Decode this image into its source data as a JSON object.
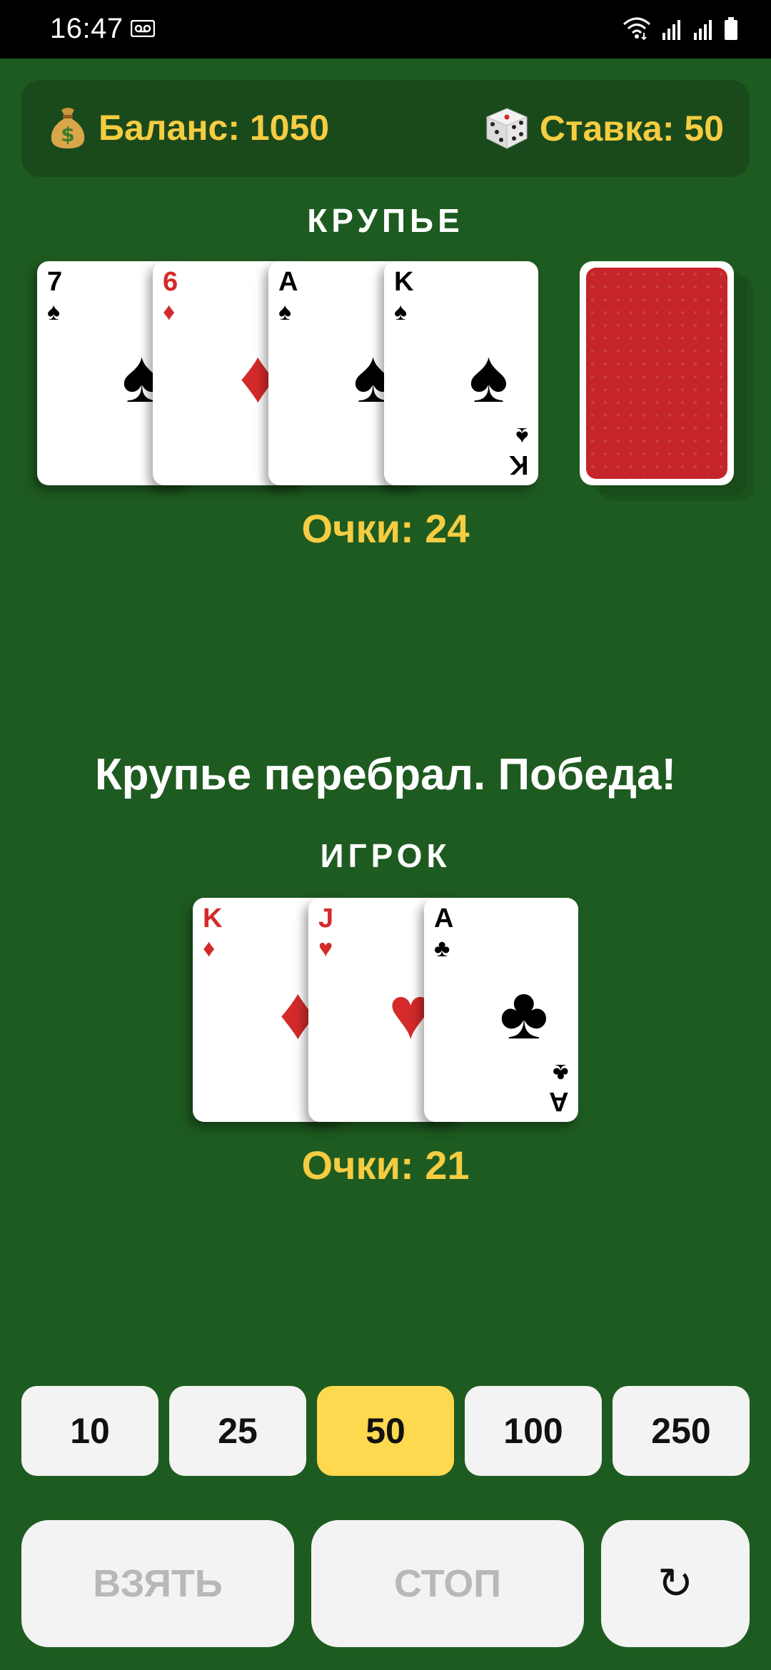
{
  "status_bar": {
    "time": "16:47"
  },
  "info": {
    "balance_label": "Баланс: 1050",
    "bet_label": "Ставка: 50",
    "balance_icon": "money-bag-icon",
    "bet_icon": "dice-icon"
  },
  "dealer": {
    "label": "КРУПЬЕ",
    "score": "Очки: 24",
    "cards": [
      {
        "rank": "7",
        "suit": "♠",
        "color": "black"
      },
      {
        "rank": "6",
        "suit": "♦",
        "color": "red"
      },
      {
        "rank": "A",
        "suit": "♠",
        "color": "black"
      },
      {
        "rank": "K",
        "suit": "♠",
        "color": "black"
      }
    ]
  },
  "message": "Крупье перебрал. Победа!",
  "player": {
    "label": "ИГРОК",
    "score": "Очки: 21",
    "cards": [
      {
        "rank": "K",
        "suit": "♦",
        "color": "red"
      },
      {
        "rank": "J",
        "suit": "♥",
        "color": "red"
      },
      {
        "rank": "A",
        "suit": "♣",
        "color": "black"
      }
    ]
  },
  "bets": [
    "10",
    "25",
    "50",
    "100",
    "250"
  ],
  "selected_bet": "50",
  "actions": {
    "take": "ВЗЯТЬ",
    "stop": "СТОП",
    "reset": "↻"
  },
  "colors": {
    "table": "#1e5b20",
    "panel": "#1a4a1b",
    "accent_yellow": "#f5cc42",
    "card_back_red": "#c4242a",
    "red_suit": "#d42a2a"
  }
}
